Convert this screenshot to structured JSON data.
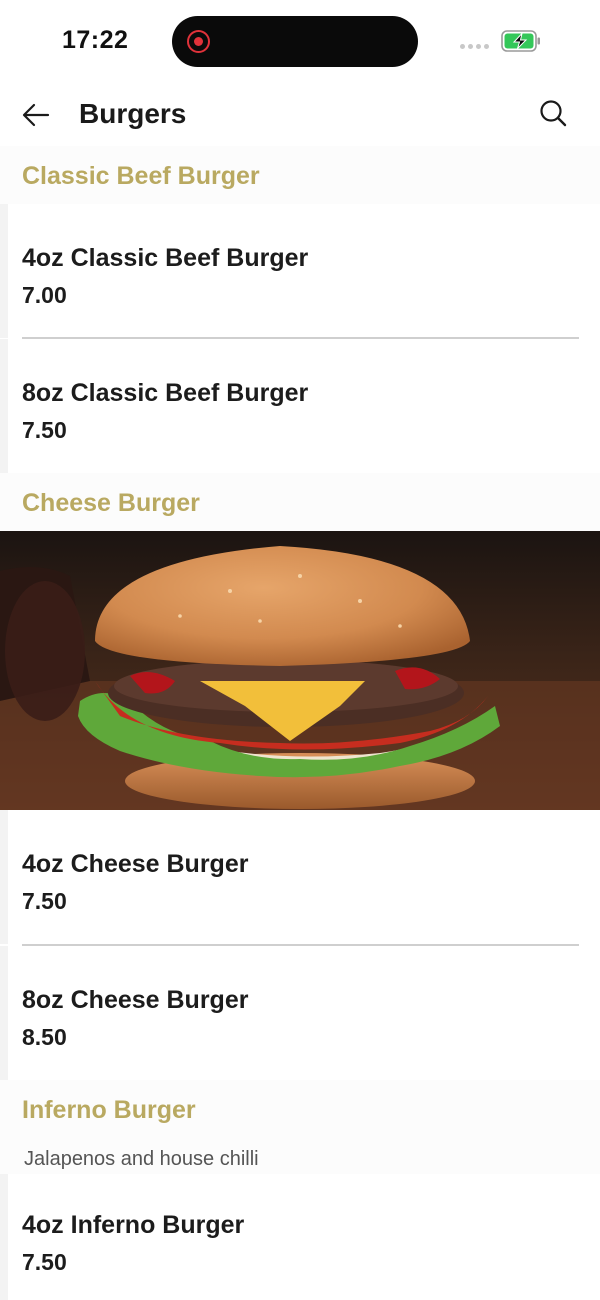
{
  "status_bar": {
    "time": "17:22",
    "icons": [
      "screen-recording-icon",
      "cellular-signal-icon",
      "battery-charging-icon"
    ]
  },
  "header": {
    "title": "Burgers",
    "back_icon": "arrow-left-icon",
    "search_icon": "search-icon"
  },
  "sections": [
    {
      "title": "Classic Beef Burger",
      "items": [
        {
          "name": "4oz Classic Beef Burger",
          "price": "7.00"
        },
        {
          "name": "8oz Classic Beef Burger",
          "price": "7.50"
        }
      ]
    },
    {
      "title": "Cheese Burger",
      "image": "cheeseburger-photo",
      "items": [
        {
          "name": "4oz Cheese Burger",
          "price": "7.50"
        },
        {
          "name": "8oz Cheese Burger",
          "price": "8.50"
        }
      ]
    },
    {
      "title": "Inferno Burger",
      "description": "Jalapenos and house chilli",
      "items": [
        {
          "name": "4oz Inferno Burger",
          "price": "7.50"
        }
      ]
    }
  ],
  "colors": {
    "section_title": "#b9a961",
    "text": "#1a1a1a",
    "divider": "#cfcfcf",
    "recording": "#e0323a",
    "battery": "#34c759"
  }
}
